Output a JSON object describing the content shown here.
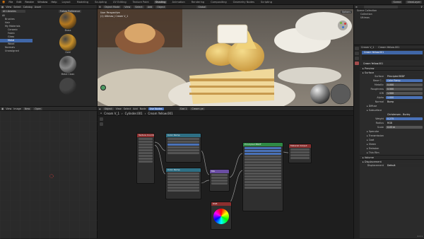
{
  "topbar": {
    "menus": [
      "File",
      "Edit",
      "Render",
      "Window",
      "Help"
    ],
    "workspaces": [
      "Layout",
      "Modeling",
      "Sculpting",
      "UV Editing",
      "Texture Paint",
      "Shading",
      "Animation",
      "Rendering",
      "Compositing",
      "Geometry Nodes",
      "Scripting"
    ],
    "active_workspace": "Shading",
    "scene": "Scene",
    "view_layer": "ViewLayer"
  },
  "asset_browser": {
    "header": [
      "View",
      "Select",
      "Catalog",
      "Asset"
    ],
    "library": "All Libraries",
    "import": "Follow Preference",
    "tree": [
      {
        "label": "All",
        "indent": 0,
        "selected": false
      },
      {
        "label": "Brushes",
        "indent": 1,
        "selected": false
      },
      {
        "label": "Hair",
        "indent": 1,
        "selected": false
      },
      {
        "label": "My Materials",
        "indent": 1,
        "selected": false
      },
      {
        "label": "Ceramic",
        "indent": 2,
        "selected": false
      },
      {
        "label": "Fabric",
        "indent": 2,
        "selected": false
      },
      {
        "label": "Glass",
        "indent": 2,
        "selected": false
      },
      {
        "label": "Metal",
        "indent": 2,
        "selected": true
      },
      {
        "label": "Wood",
        "indent": 2,
        "selected": false
      },
      {
        "label": "Normals",
        "indent": 1,
        "selected": false
      },
      {
        "label": "Unassigned",
        "indent": 1,
        "selected": false
      }
    ],
    "thumbnails": [
      {
        "name": "Brass",
        "color": "#b5781f"
      },
      {
        "name": "Gold",
        "color": "#c8902a"
      },
      {
        "name": "Metal Clean",
        "color": "#8a8a8a"
      },
      {
        "name": "",
        "color": "#444444"
      }
    ]
  },
  "image_editor": {
    "header": [
      "View",
      "Image"
    ],
    "new_label": "New",
    "open_label": "Open"
  },
  "viewport": {
    "mode": "Object Mode",
    "header": [
      "View",
      "Select",
      "Add",
      "Object"
    ],
    "orientation": "Global",
    "info_line1": "User Perspective",
    "info_line2": "(1) Ultimas | Cream V_1",
    "options": "Options"
  },
  "node_editor": {
    "object_label": "Object",
    "header": [
      "View",
      "Select",
      "Add",
      "Node"
    ],
    "use_nodes": "Use Nodes",
    "slot": "Slot 1",
    "material_field": "Cream ye",
    "breadcrumb": [
      "Cream V_1",
      "Cylinder.001",
      "Cream Yellow.001"
    ],
    "nodes": [
      {
        "title": "Texture Coordinate",
        "color": "#8c2f2f"
      },
      {
        "title": "Color Ramp",
        "color": "#2e6f84"
      },
      {
        "title": "Color Ramp",
        "color": "#2e6f84"
      },
      {
        "title": "Mix",
        "color": "#6a4da3"
      },
      {
        "title": "Principled BSDF",
        "color": "#2f8a45"
      },
      {
        "title": "Material Output",
        "color": "#8c2f2f"
      },
      {
        "title": "RGB",
        "color": "#8c2f2f"
      }
    ]
  },
  "outliner": {
    "title": "Scene Collection",
    "items": [
      {
        "label": "Collection",
        "indent": 1,
        "selected": false
      },
      {
        "label": "Ultimas",
        "indent": 1,
        "selected": false
      }
    ]
  },
  "properties": {
    "object": "Cream V_1",
    "material_slot": "Cream Yellow.001",
    "material_field": "Cream Yellow.001",
    "sections_top": [
      "Preview",
      "Surface"
    ],
    "surface_label": "Surface",
    "surface_value": "Principled BSDF",
    "rows": [
      {
        "label": "Base C...",
        "value": "Color Ramp",
        "style": "blue"
      },
      {
        "label": "Metallic",
        "value": "0.000",
        "style": "normal"
      },
      {
        "label": "Roughness",
        "value": "0.500",
        "style": "normal"
      },
      {
        "label": "IOR",
        "value": "1.500",
        "style": "normal"
      },
      {
        "label": "Alpha",
        "value": "1.000",
        "style": "blue"
      },
      {
        "label": "Normal",
        "value": "Bump",
        "style": "dark"
      }
    ],
    "subsections": [
      "Diffuse",
      "Subsurface"
    ],
    "subsurface_rows": [
      {
        "label": "",
        "value": "Christensen - Burley",
        "style": "dark"
      },
      {
        "label": "Weight",
        "value": "0.275",
        "style": "blue"
      },
      {
        "label": "Radius",
        "value": "RGB",
        "style": "dark"
      },
      {
        "label": "Scale",
        "value": "0.05 m",
        "style": "normal"
      }
    ],
    "more_sections": [
      "Specular",
      "Transmission",
      "Coat",
      "Sheen",
      "Emission",
      "Thin Film"
    ],
    "bottom_sections": [
      "Volume",
      "Displacement"
    ],
    "displacement_label": "Displacement",
    "displacement_value": "Default",
    "version": "4.2.1"
  }
}
